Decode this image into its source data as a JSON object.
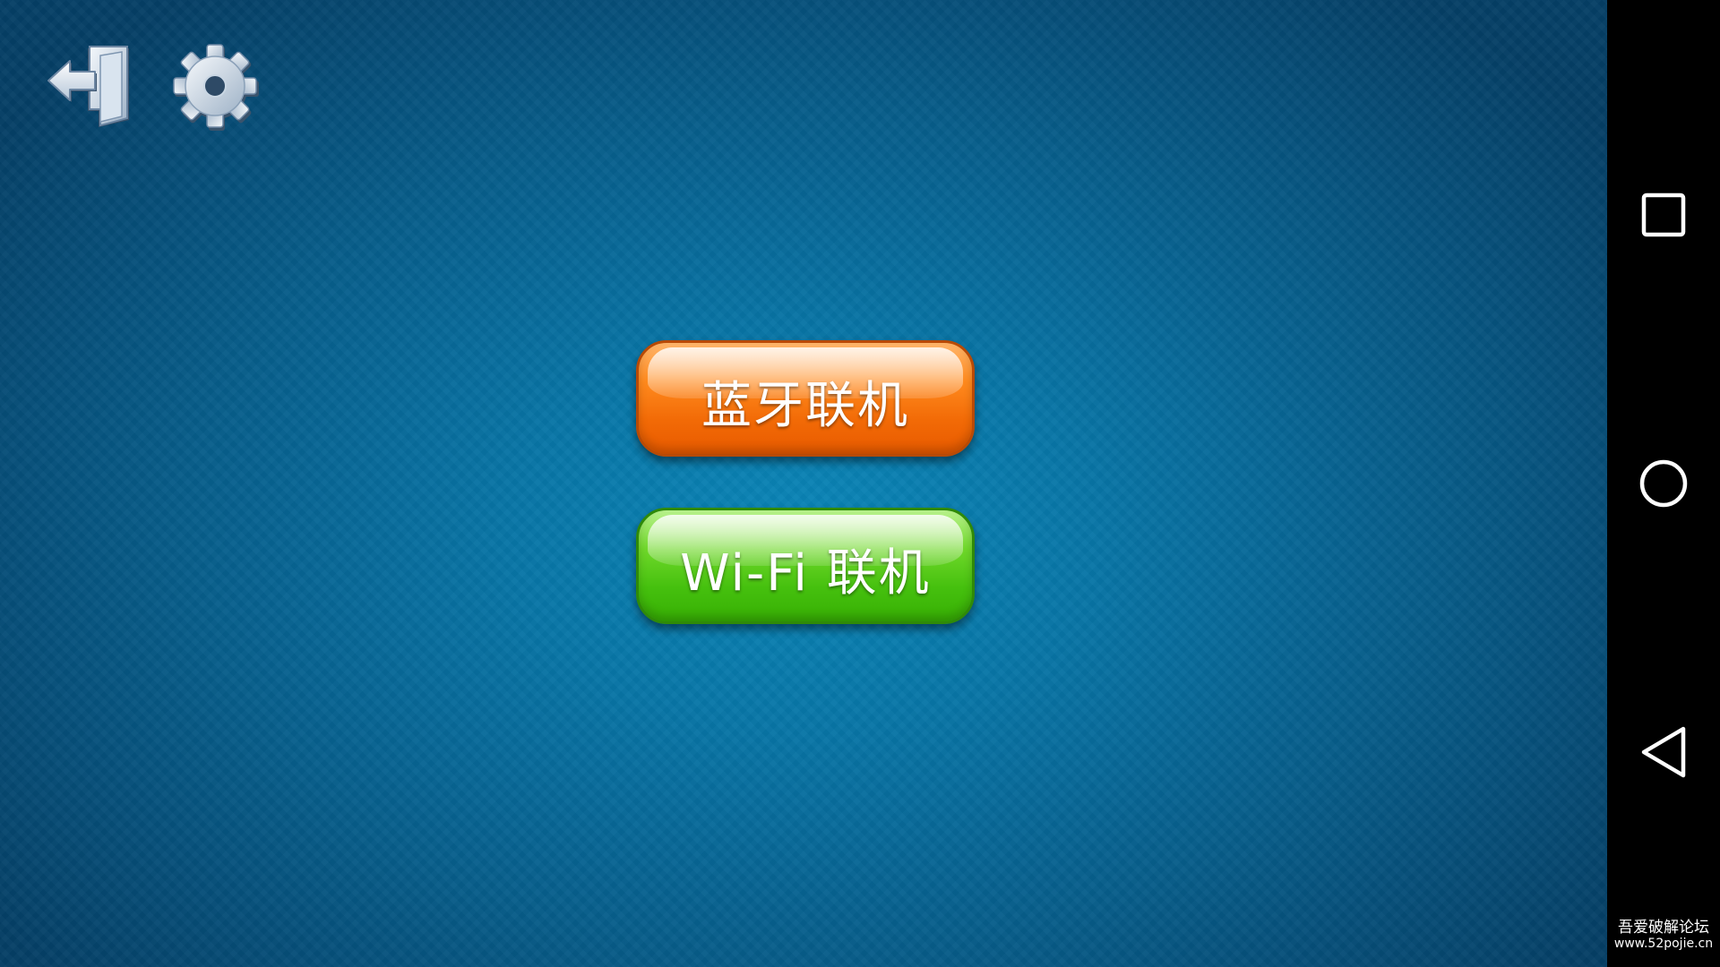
{
  "toolbar": {
    "exit_icon": "exit-door-icon",
    "settings_icon": "gear-icon"
  },
  "menu": {
    "bluetooth_label": "蓝牙联机",
    "wifi_label": "Wi-Fi 联机"
  },
  "colors": {
    "background_center": "#0a86b8",
    "background_edge": "#053f66",
    "bluetooth_button": "#f26a06",
    "wifi_button": "#45c00e"
  },
  "nav_bar": {
    "recents_icon": "square-icon",
    "home_icon": "circle-icon",
    "back_icon": "triangle-back-icon"
  },
  "watermark": {
    "title": "吾爱破解论坛",
    "url": "www.52pojie.cn"
  }
}
